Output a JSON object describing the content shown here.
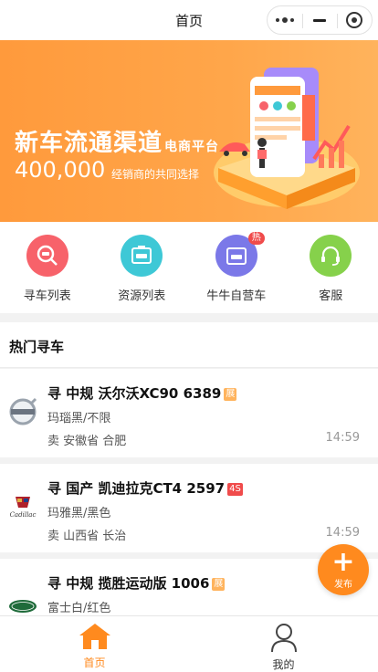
{
  "nav": {
    "title": "首页"
  },
  "banner": {
    "headline": "新车流通渠道",
    "headline_suffix": "电商平台",
    "number": "400,000",
    "number_desc": "经销商的共同选择",
    "colors": {
      "from": "#ff9a3c",
      "to": "#ffb35c"
    }
  },
  "quick_menu": [
    {
      "label": "寻车列表",
      "icon": "car-search-icon",
      "color": "#f7626a"
    },
    {
      "label": "资源列表",
      "icon": "car-resource-icon",
      "color": "#3ec8d6"
    },
    {
      "label": "牛牛自营车",
      "icon": "store-car-icon",
      "color": "#7b78e8",
      "badge": "热"
    },
    {
      "label": "客服",
      "icon": "headset-icon",
      "color": "#86d14b"
    }
  ],
  "section": {
    "title": "热门寻车"
  },
  "listings": [
    {
      "title": "寻 中规 沃尔沃XC90 6389",
      "tag": "展",
      "colors": "玛瑙黑/不限",
      "location": "卖 安徽省 合肥",
      "time": "14:59",
      "brand_icon": "volvo-logo-icon"
    },
    {
      "title": "寻 国产 凯迪拉克CT4 2597",
      "tag": "4S",
      "colors": "玛雅黑/黑色",
      "location": "卖 山西省 长治",
      "time": "14:59",
      "brand_icon": "cadillac-logo-icon"
    },
    {
      "title": "寻 中规 揽胜运动版 1006",
      "tag": "展",
      "colors": "富士白/红色",
      "location": "",
      "time": "",
      "brand_icon": "land-rover-logo-icon"
    }
  ],
  "fab": {
    "label": "发布"
  },
  "tabbar": [
    {
      "label": "首页",
      "active": true,
      "color": "#ff8a1e"
    },
    {
      "label": "我的",
      "active": false,
      "color": "#333333"
    }
  ]
}
